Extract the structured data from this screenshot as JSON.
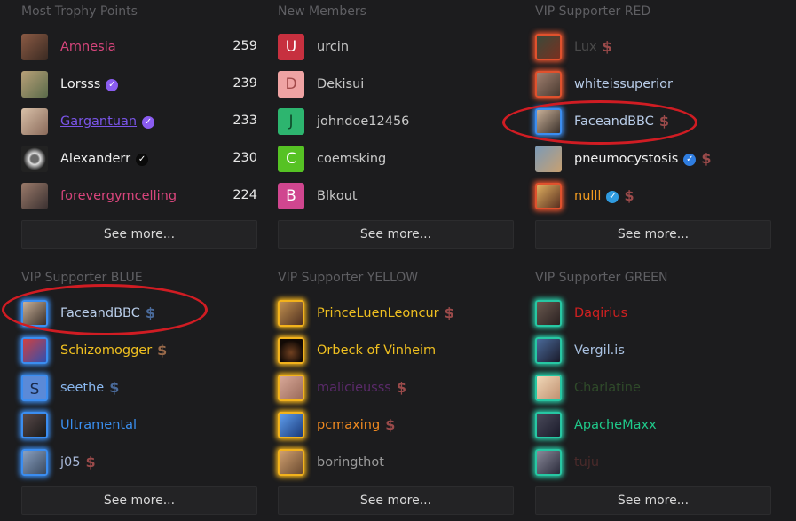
{
  "colors": {
    "red_glow": "#e0512d",
    "blue_glow": "#3b8df0",
    "yellow_glow": "#f2b21c",
    "green_glow": "#27c7a3",
    "annotation": "#d01c23"
  },
  "see_more": "See more...",
  "trophy": {
    "title": "Most Trophy Points",
    "rows": [
      {
        "name": "Amnesia",
        "count": "259"
      },
      {
        "name": "Lorsss",
        "count": "239"
      },
      {
        "name": "Gargantuan",
        "count": "233"
      },
      {
        "name": "Alexanderr",
        "count": "230"
      },
      {
        "name": "forevergymcelling",
        "count": "224"
      }
    ]
  },
  "new_members": {
    "title": "New Members",
    "rows": [
      {
        "letter": "U",
        "name": "urcin"
      },
      {
        "letter": "D",
        "name": "Dekisui"
      },
      {
        "letter": "J",
        "name": "johndoe12456"
      },
      {
        "letter": "C",
        "name": "coemsking"
      },
      {
        "letter": "B",
        "name": "Blkout"
      }
    ]
  },
  "vip_red": {
    "title": "VIP Supporter RED",
    "rows": [
      {
        "name": "Lux"
      },
      {
        "name": "whiteissuperior"
      },
      {
        "name": "FaceandBBC"
      },
      {
        "name": "pneumocystosis"
      },
      {
        "name": "nulll"
      }
    ]
  },
  "vip_blue": {
    "title": "VIP Supporter BLUE",
    "rows": [
      {
        "name": "FaceandBBC"
      },
      {
        "name": "Schizomogger"
      },
      {
        "letter": "S",
        "name": "seethe"
      },
      {
        "name": "Ultramental"
      },
      {
        "name": "j05"
      }
    ]
  },
  "vip_yellow": {
    "title": "VIP Supporter YELLOW",
    "rows": [
      {
        "name": "PrinceLuenLeoncur"
      },
      {
        "name": "Orbeck of Vinheim"
      },
      {
        "name": "malicieusss"
      },
      {
        "name": "pcmaxing"
      },
      {
        "name": "boringthot"
      }
    ]
  },
  "vip_green": {
    "title": "VIP Supporter GREEN",
    "rows": [
      {
        "name": "Daqirius"
      },
      {
        "name": "Vergil.is"
      },
      {
        "name": "Charlatine"
      },
      {
        "name": "ApacheMaxx"
      },
      {
        "name": "tuju"
      }
    ]
  }
}
